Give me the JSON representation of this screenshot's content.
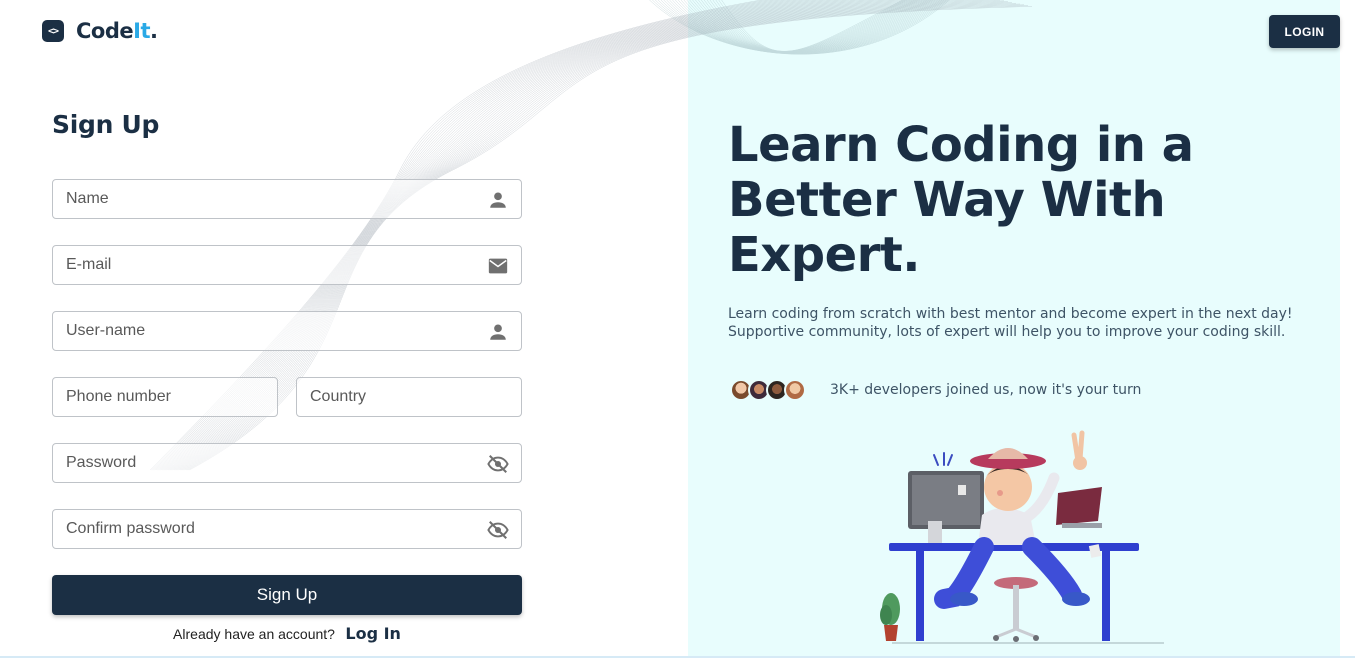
{
  "brand": {
    "name_prefix": "Code",
    "name_accent": "It",
    "name_suffix": ".",
    "mark": "<>"
  },
  "header": {
    "login_label": "LOGIN"
  },
  "form": {
    "title": "Sign Up",
    "fields": {
      "name": {
        "placeholder": "Name",
        "icon": "person-icon"
      },
      "email": {
        "placeholder": "E-mail",
        "icon": "mail-icon"
      },
      "username": {
        "placeholder": "User-name",
        "icon": "person-icon"
      },
      "phone": {
        "placeholder": "Phone number"
      },
      "country": {
        "placeholder": "Country"
      },
      "password": {
        "placeholder": "Password",
        "icon": "eye-off-icon"
      },
      "confirm_password": {
        "placeholder": "Confirm password",
        "icon": "eye-off-icon"
      }
    },
    "submit_label": "Sign Up",
    "account_question": "Already have an account?",
    "login_link": "Log In"
  },
  "hero": {
    "title": "Learn Coding in a Better Way With Expert.",
    "description": "Learn coding from scratch with best mentor and become expert in the next day! Supportive community, lots of expert will help you to improve your coding skill.",
    "joined_text": "3K+ developers joined us, now it's your turn",
    "avatars": [
      "avatar-1",
      "avatar-2",
      "avatar-3",
      "avatar-4"
    ]
  },
  "colors": {
    "primary": "#1b2f44",
    "accent": "#2aa9e6",
    "panel_bg": "#e8fdfd"
  }
}
